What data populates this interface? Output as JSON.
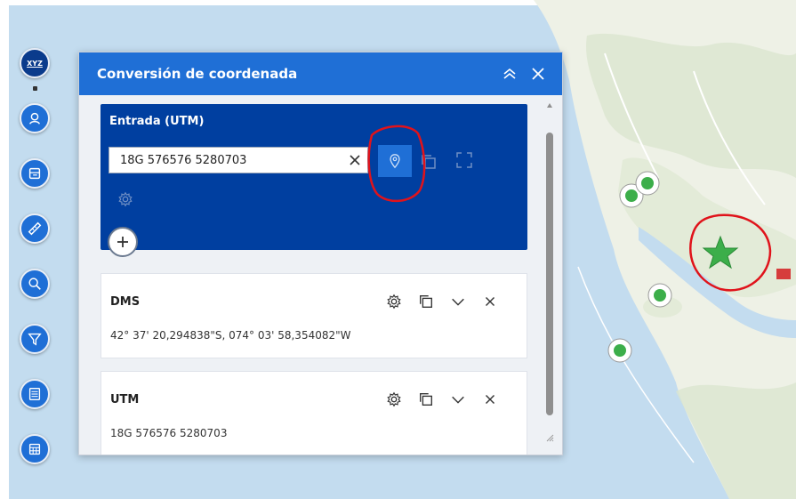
{
  "panel": {
    "title": "Conversión de coordenada"
  },
  "input": {
    "title": "Entrada (UTM)",
    "value": "18G 576576 5280703"
  },
  "outputs": [
    {
      "title": "DMS",
      "value": "42° 37' 20,294838\"S, 074° 03' 58,354082\"W"
    },
    {
      "title": "UTM",
      "value": "18G 576576 5280703"
    }
  ],
  "toolbar": {
    "top_label": "XYZ",
    "icons": [
      "coordinate-conversion-icon",
      "locate-icon",
      "layers-icon",
      "measure-icon",
      "search-icon",
      "filter-icon",
      "table-icon",
      "calculator-icon"
    ]
  },
  "colors": {
    "header_blue": "#1f6fd6",
    "input_panel_blue": "#003fa0",
    "annotation_red": "#e0131b",
    "map_water": "#bcd8ee",
    "map_land": "#eef1e6",
    "marker_green": "#3cae4a"
  }
}
